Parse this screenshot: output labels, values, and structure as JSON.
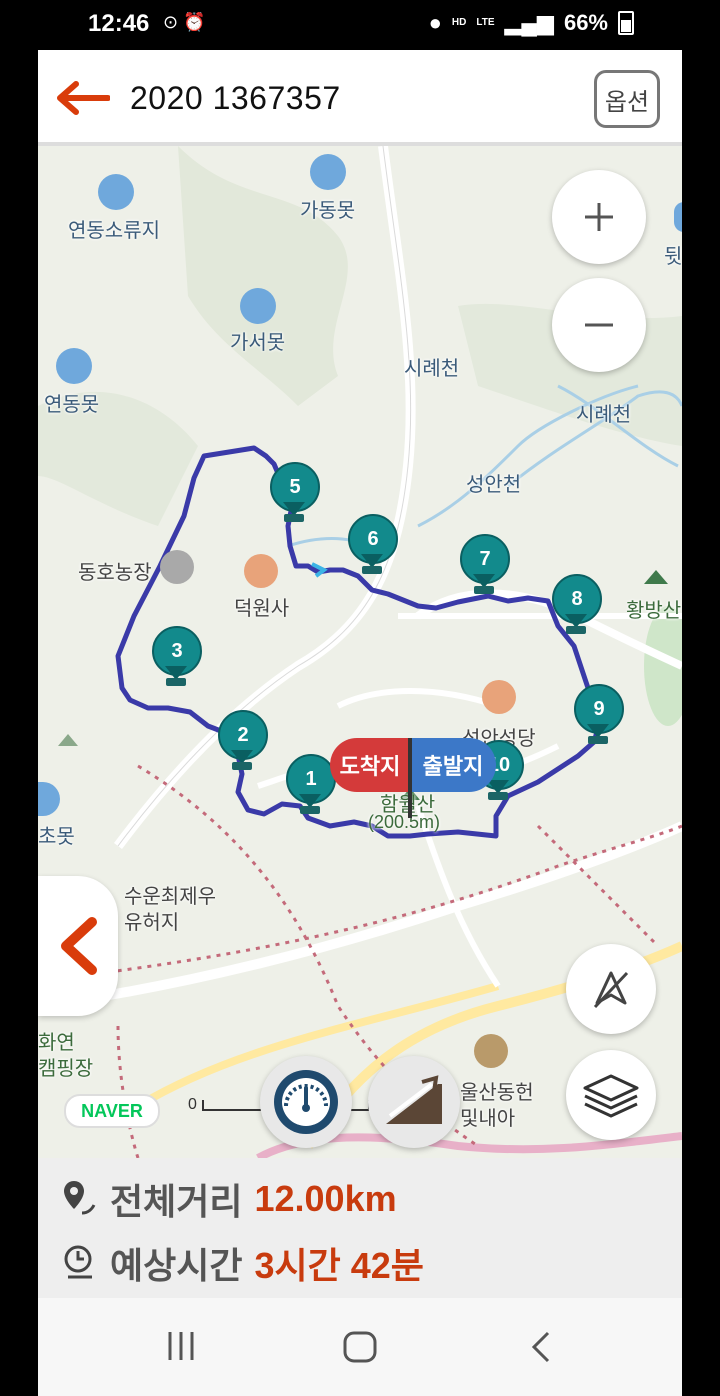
{
  "status_bar": {
    "time": "12:46",
    "battery": "66%",
    "network_hd": "HD",
    "network_lte": "LTE"
  },
  "header": {
    "title": "2020 1367357",
    "options_label": "옵션"
  },
  "map": {
    "labels": {
      "yeondong_soryuji": "연동소류지",
      "gadongmot": "가동못",
      "gaseomot": "가서못",
      "yeondongmot": "연동못",
      "siryecheon_1": "시례천",
      "siryecheon_2": "시례천",
      "seongancheon": "성안천",
      "dongho_farm": "동호농장",
      "deogwonsa": "덕원사",
      "hwangbangsan": "황방산",
      "seongan_church": "성안성당",
      "hamwolsan": "함월산",
      "hamwolsan_height": "(200.5m)",
      "suun_site_1": "수운최제우",
      "suun_site_2": "유허지",
      "hwayeon_1": "화연",
      "hwayeon_2": "캠핑장",
      "ulsan_1": "울산동헌",
      "ulsan_2": "및내아",
      "chomot": "초못",
      "edge_right": "뒷"
    },
    "markers": [
      "1",
      "2",
      "3",
      "5",
      "6",
      "7",
      "8",
      "9",
      "10"
    ],
    "flags": {
      "end": "도착지",
      "start": "출발지"
    },
    "naver": "NAVER",
    "scale_zero": "0",
    "scale_unit": "m"
  },
  "route": {
    "color": "#3a3aa8"
  },
  "info": {
    "distance_label": "전체거리",
    "distance_value": "12.00km",
    "time_label": "예상시간",
    "time_value": "3시간 42분"
  },
  "colors": {
    "accent": "#c83b0e",
    "marker": "#128a8c",
    "end_flag": "#d43a3a",
    "start_flag": "#3c78c8"
  }
}
